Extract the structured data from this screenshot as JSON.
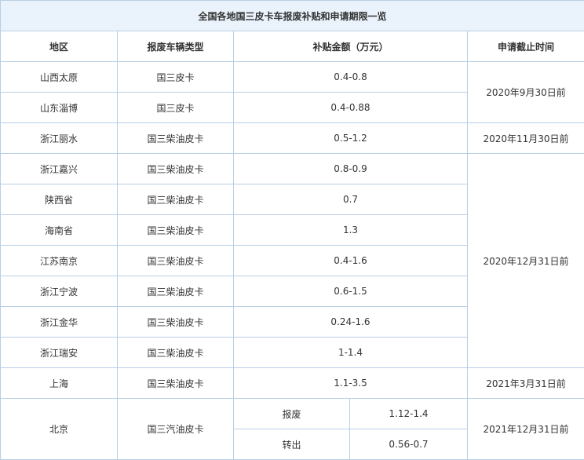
{
  "title": "全国各地国三皮卡车报废补贴和申请期限一览",
  "headers": {
    "region": "地区",
    "vehicle_type": "报废车辆类型",
    "subsidy": "补贴金额（万元）",
    "deadline": "申请截止时间"
  },
  "rows": [
    {
      "region": "山西太原",
      "type": "国三皮卡",
      "subsidy": "0.4-0.8"
    },
    {
      "region": "山东淄博",
      "type": "国三皮卡",
      "subsidy": "0.4-0.88"
    },
    {
      "region": "浙江丽水",
      "type": "国三柴油皮卡",
      "subsidy": "0.5-1.2"
    },
    {
      "region": "浙江嘉兴",
      "type": "国三柴油皮卡",
      "subsidy": "0.8-0.9"
    },
    {
      "region": "陕西省",
      "type": "国三柴油皮卡",
      "subsidy": "0.7"
    },
    {
      "region": "海南省",
      "type": "国三柴油皮卡",
      "subsidy": "1.3"
    },
    {
      "region": "江苏南京",
      "type": "国三柴油皮卡",
      "subsidy": "0.4-1.6"
    },
    {
      "region": "浙江宁波",
      "type": "国三柴油皮卡",
      "subsidy": "0.6-1.5"
    },
    {
      "region": "浙江金华",
      "type": "国三柴油皮卡",
      "subsidy": "0.24-1.6"
    },
    {
      "region": "浙江瑞安",
      "type": "国三柴油皮卡",
      "subsidy": "1-1.4"
    },
    {
      "region": "上海",
      "type": "国三柴油皮卡",
      "subsidy": "1.1-3.5"
    }
  ],
  "deadlines": {
    "shanxi_shandong": "2020年9月30日前",
    "lishui": "2020年11月30日前",
    "group_dec2020": "2020年12月31日前",
    "shanghai": "2021年3月31日前",
    "beijing": "2021年12月31日前"
  },
  "beijing": {
    "region": "北京",
    "type": "国三汽油皮卡",
    "scrap_label": "报废",
    "scrap_value": "1.12-1.4",
    "transfer_label": "转出",
    "transfer_value": "0.56-0.7"
  }
}
